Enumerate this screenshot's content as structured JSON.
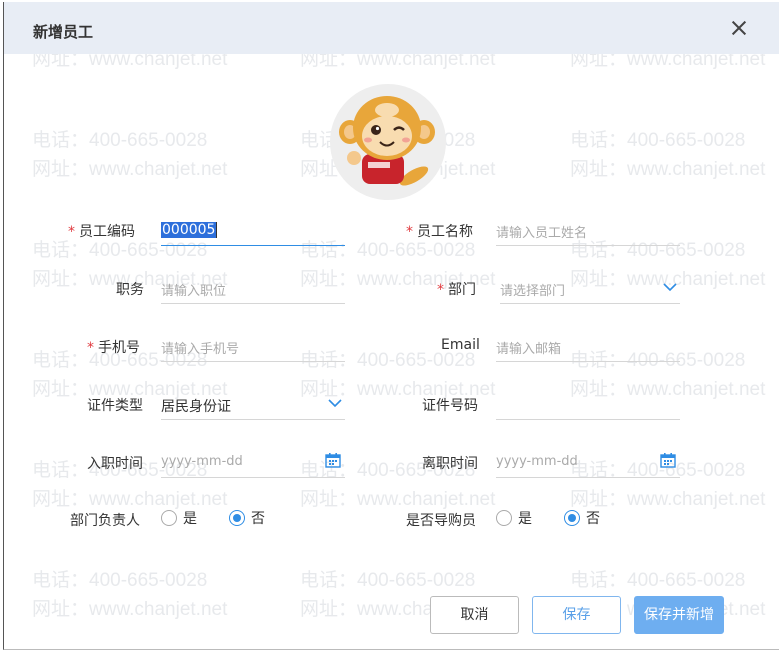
{
  "dialog": {
    "title": "新增员工"
  },
  "watermark": {
    "phone": "电话：400-665-0028",
    "site": "网址：www.chanjet.net"
  },
  "form": {
    "employee_code": {
      "label": "员工编码",
      "value": "000005"
    },
    "employee_name": {
      "label": "员工名称",
      "placeholder": "请输入员工姓名"
    },
    "position": {
      "label": "职务",
      "placeholder": "请输入职位"
    },
    "department": {
      "label": "部门",
      "placeholder": "请选择部门"
    },
    "mobile": {
      "label": "手机号",
      "placeholder": "请输入手机号"
    },
    "email": {
      "label": "Email",
      "placeholder": "请输入邮箱"
    },
    "id_type": {
      "label": "证件类型",
      "value": "居民身份证"
    },
    "id_number": {
      "label": "证件号码"
    },
    "hire_date": {
      "label": "入职时间",
      "placeholder": "yyyy-mm-dd"
    },
    "leave_date": {
      "label": "离职时间",
      "placeholder": "yyyy-mm-dd"
    },
    "dept_head": {
      "label": "部门负责人",
      "options": [
        "是",
        "否"
      ],
      "selected": "否"
    },
    "shopping_guide": {
      "label": "是否导购员",
      "options": [
        "是",
        "否"
      ],
      "selected": "否"
    },
    "required_mark": "*"
  },
  "buttons": {
    "cancel": "取消",
    "save": "保存",
    "save_and_new": "保存并新增"
  },
  "colors": {
    "accent": "#2f8de4",
    "required": "#e0393e",
    "header_bg": "#e8edf5",
    "primary_btn": "#6eaef0"
  }
}
